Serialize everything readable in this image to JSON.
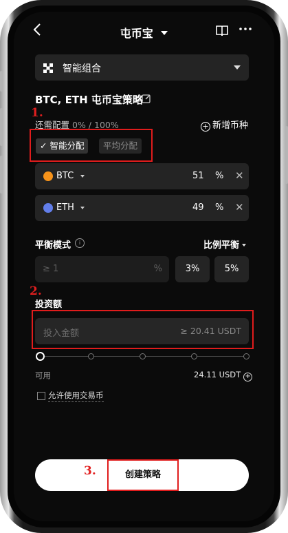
{
  "header": {
    "title": "屯币宝",
    "back_icon": "chevron-left-icon",
    "book_icon": "book-icon",
    "more_icon": "more-horizontal-icon"
  },
  "combo_selector": {
    "label": "智能组合",
    "icon": "grid-icon"
  },
  "strategy": {
    "title": "BTC, ETH 屯币宝策略",
    "edit_icon": "edit-icon"
  },
  "annotations": {
    "step1": "1.",
    "step2": "2.",
    "step3": "3.",
    "color": "#e01c1c"
  },
  "allocation": {
    "label": "还需配置",
    "value": "0% / 100%",
    "add_coin": "新增币种",
    "smart_chip": "✓ 智能分配",
    "even_chip": "平均分配"
  },
  "coins": [
    {
      "name": "BTC",
      "percent": "51",
      "unit": "%",
      "logo_color": "#f7931a"
    },
    {
      "name": "ETH",
      "percent": "49",
      "unit": "%",
      "logo_color": "#627eea"
    }
  ],
  "balance": {
    "label": "平衡模式",
    "mode": "比例平衡",
    "input_placeholder": "≥ 1",
    "input_unit": "%",
    "options": [
      "3%",
      "5%"
    ]
  },
  "investment": {
    "label": "投资额",
    "placeholder": "投入金额",
    "min_hint": "≥ 20.41 USDT",
    "available_label": "可用",
    "available_value": "24.11 USDT",
    "slider_percent": 0
  },
  "trade_coin_checkbox": {
    "label": "允许使用交易币",
    "checked": false
  },
  "create_button": {
    "label": "创建策略"
  }
}
